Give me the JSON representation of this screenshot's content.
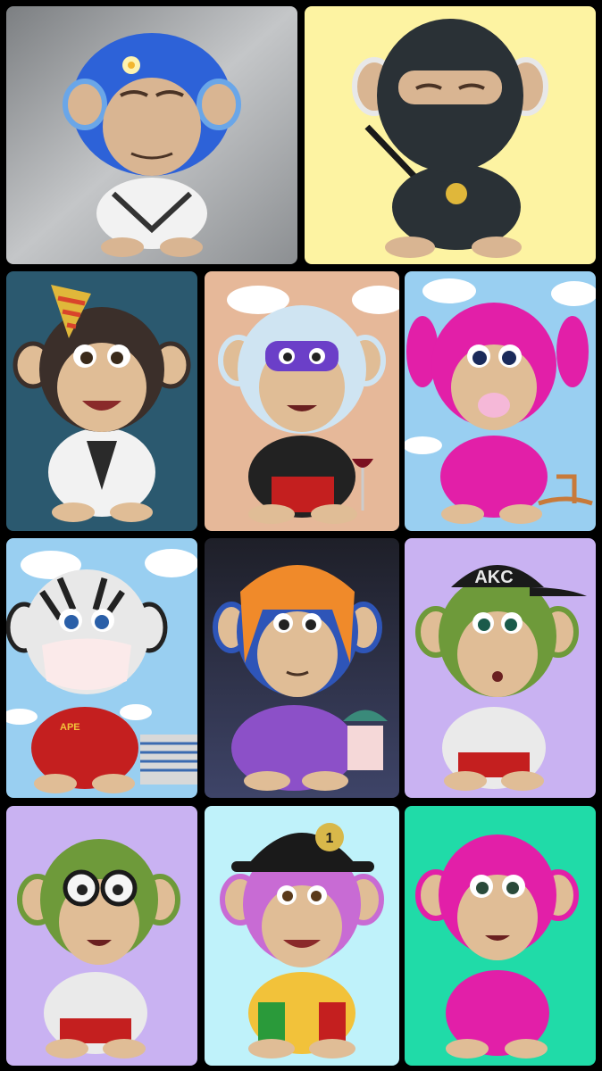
{
  "gallery": {
    "tiles": [
      {
        "bg": "#9a9c9e",
        "fur": "#2d62d8",
        "face": "#d9b592",
        "outfit": "#f2f2f2",
        "label": "",
        "accessory": "flower-hair"
      },
      {
        "bg": "#fdf3a2",
        "fur": "#2a3136",
        "face": "#d9b592",
        "outfit": "#2a3136",
        "label": "",
        "accessory": "ninja-mask"
      },
      {
        "bg": "#2b596f",
        "fur": "#3b2f2a",
        "face": "#e0bd96",
        "outfit": "#f2f2f2",
        "label": "",
        "accessory": "party-hat"
      },
      {
        "bg": "#e6b899",
        "fur": "#cfe4f2",
        "face": "#e0bd96",
        "outfit": "#222",
        "label": "",
        "accessory": "purple-mask"
      },
      {
        "bg": "#99cff1",
        "fur": "#e21fa8",
        "face": "#e0bd96",
        "outfit": "#e21fa8",
        "label": "",
        "accessory": "pigtails"
      },
      {
        "bg": "#99cff1",
        "fur": "#e8e8e8",
        "face": "#e0bd96",
        "outfit": "#c41f1f",
        "label": "APE",
        "accessory": "zebra-mask"
      },
      {
        "bg": "#2a2c3c",
        "fur": "#2e55b8",
        "face": "#e0bd96",
        "outfit": "#8c50c8",
        "label": "",
        "accessory": "orange-hair"
      },
      {
        "bg": "#c9b2f2",
        "fur": "#6e9a3a",
        "face": "#e0bd96",
        "outfit": "#eaeaea",
        "label": "AKC",
        "accessory": "cap"
      },
      {
        "bg": "#c9b2f2",
        "fur": "#6e9a3a",
        "face": "#e0bd96",
        "outfit": "#eaeaea",
        "label": "",
        "accessory": "glasses"
      },
      {
        "bg": "#bff2fa",
        "fur": "#c86bd4",
        "face": "#e0bd96",
        "outfit": "#f2c23a",
        "label": "1",
        "accessory": "fire-helmet"
      },
      {
        "bg": "#20dba8",
        "fur": "#e21fa8",
        "face": "#e0bd96",
        "outfit": "#e21fa8",
        "label": "",
        "accessory": "none"
      }
    ]
  }
}
